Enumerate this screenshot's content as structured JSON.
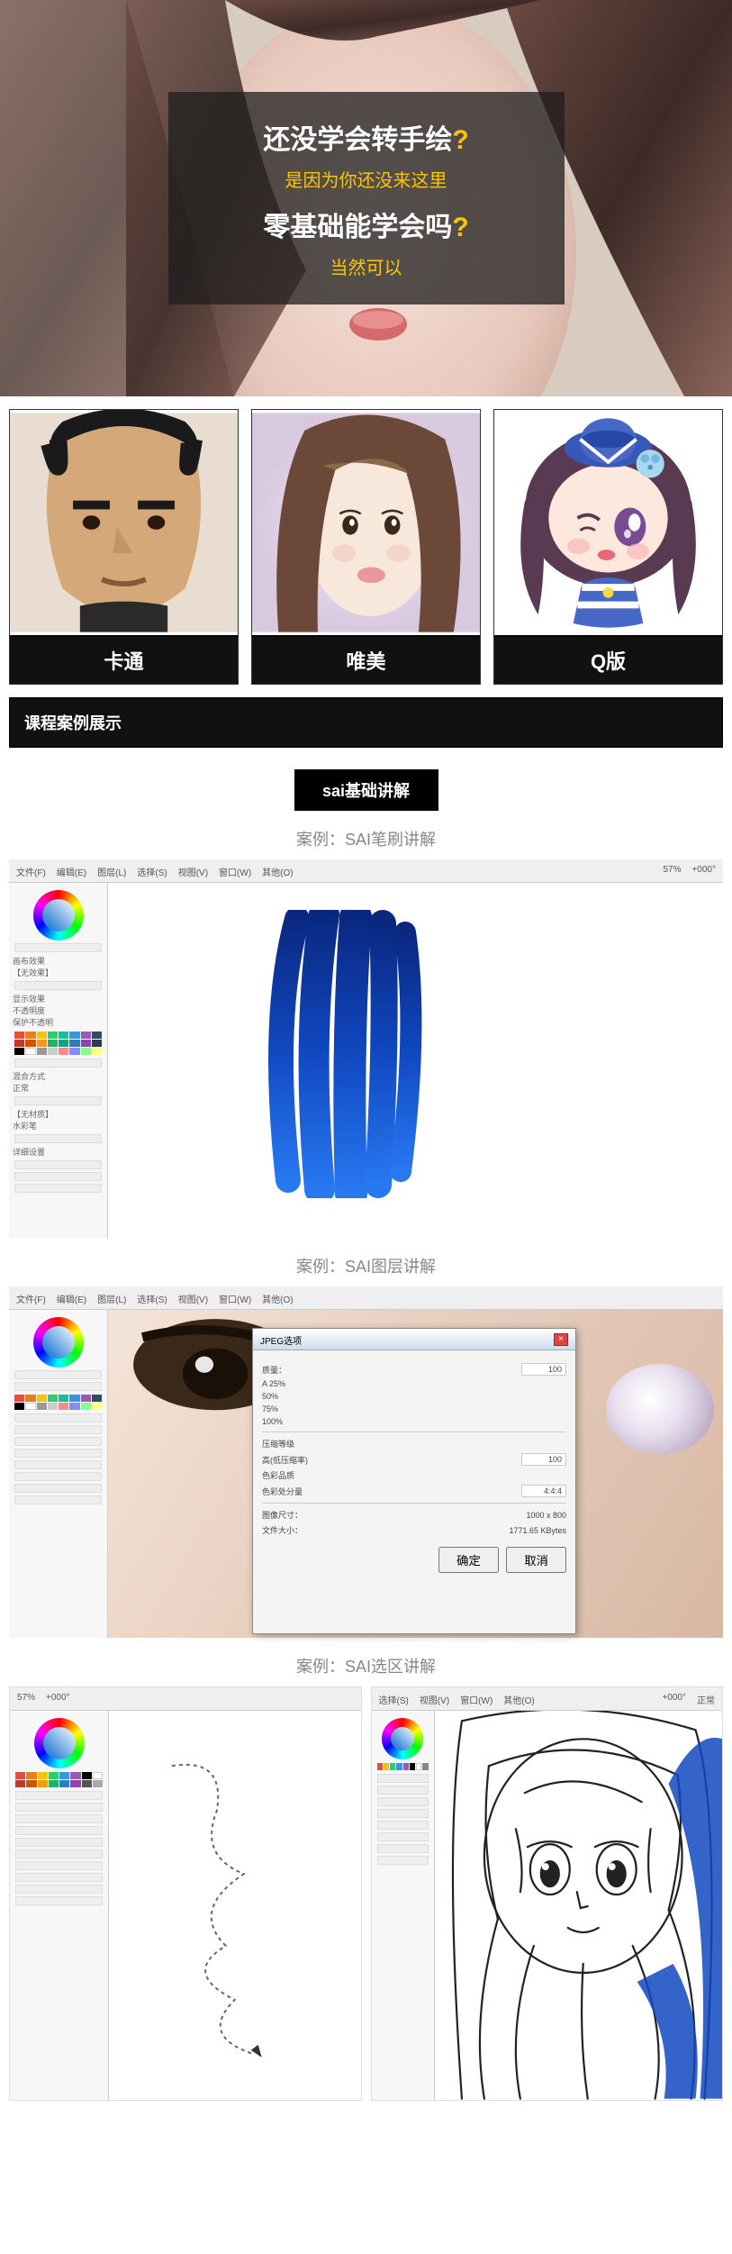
{
  "hero": {
    "q1_pre": "还没学会转手绘",
    "q1_mark": "?",
    "a1": "是因为你还没来这里",
    "q2_pre": "零基础能学会吗",
    "q2_mark": "?",
    "a2": "当然可以"
  },
  "styles": [
    {
      "label": "卡通"
    },
    {
      "label": "唯美"
    },
    {
      "label": "Q版"
    }
  ],
  "section_bar": "课程案例展示",
  "sai_badge": "sai基础讲解",
  "cases": [
    {
      "title": "案例：SAI笔刷讲解"
    },
    {
      "title": "案例：SAI图层讲解"
    },
    {
      "title": "案例：SAI选区讲解"
    }
  ],
  "sai_menu": [
    "文件(F)",
    "编辑(E)",
    "图层(L)",
    "选择(S)",
    "视图(V)",
    "窗口(W)",
    "其他(O)"
  ],
  "sai_toolbar": {
    "zoom": "57%",
    "angle": "+000°",
    "tool": "正常"
  },
  "jpeg_dialog": {
    "title": "JPEG选项",
    "rows": [
      {
        "k": "质量：",
        "v": "100"
      },
      {
        "k": "A 25%",
        "v": ""
      },
      {
        "k": "50%",
        "v": ""
      },
      {
        "k": "75%",
        "v": ""
      },
      {
        "k": "100%",
        "v": ""
      },
      {
        "k": "压缩等级",
        "v": ""
      },
      {
        "k": "高(低压缩率)",
        "v": "100"
      },
      {
        "k": "色彩品质",
        "v": ""
      },
      {
        "k": "色彩处分量",
        "v": "4:4:4"
      },
      {
        "k": "图像尺寸：",
        "v": "1000 x 800"
      },
      {
        "k": "文件大小：",
        "v": "1771.65 KBytes"
      }
    ],
    "ok": "确定",
    "cancel": "取消"
  },
  "sai_left_labels": [
    "画布效果",
    "【无效果】",
    "显示效果",
    "不透明度",
    "保护不透明",
    "混合方式",
    "正常",
    "【无材质】",
    "水彩笔",
    "详细设置"
  ],
  "swatch_colors": [
    "#e74c3c",
    "#e67e22",
    "#f1c40f",
    "#2ecc71",
    "#1abc9c",
    "#3498db",
    "#9b59b6",
    "#34495e",
    "#c0392b",
    "#d35400",
    "#f39c12",
    "#27ae60",
    "#16a085",
    "#2980b9",
    "#8e44ad",
    "#2c3e50",
    "#ecf0f1",
    "#bdc3c7",
    "#95a5a6",
    "#7f8c8d",
    "#000",
    "#fff",
    "#f88",
    "#88f"
  ]
}
